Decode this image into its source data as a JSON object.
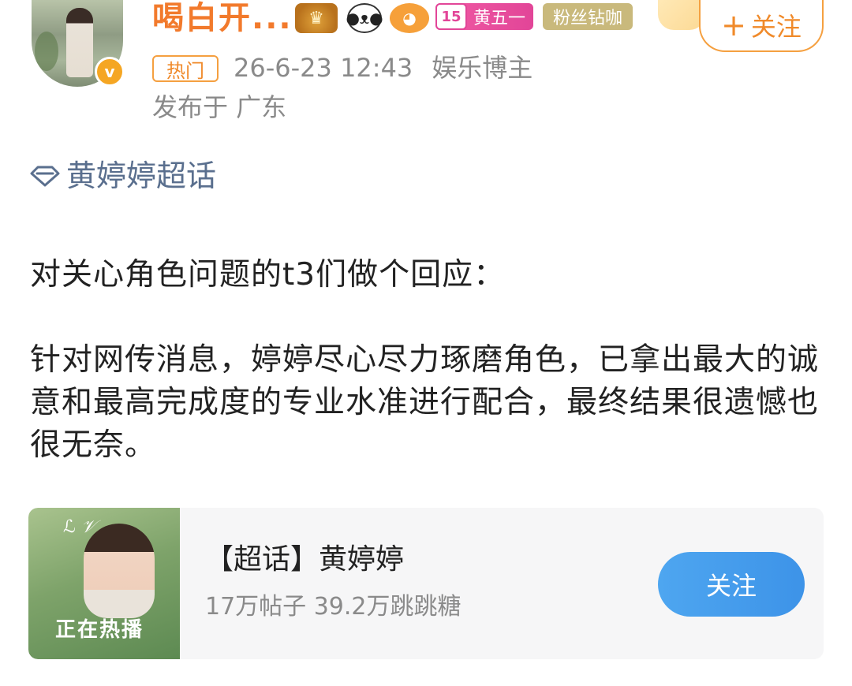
{
  "user": {
    "name": "喝白开...",
    "verified_mark": "v",
    "medals": [
      "crown-medal-icon",
      "panda-medal-icon",
      "fish-medal-icon"
    ],
    "level_badge": {
      "level": "15",
      "label": "黄五一"
    },
    "fan_badge": "粉丝钻咖",
    "follow_button": "关注",
    "follow_plus": "+"
  },
  "post_meta": {
    "hot_tag": "热门",
    "timestamp": "26-6-23 12:43",
    "category": "娱乐博主",
    "location": "发布于 广东"
  },
  "topic": {
    "label": "黄婷婷超话",
    "icon": "supertopic-diamond-icon"
  },
  "post": {
    "paragraphs": [
      "对关心角色问题的t3们做个回应：",
      "针对网传消息，婷婷尽心尽力琢磨角色，已拿出最大的诚意和最高完成度的专业水准进行配合，最终结果很遗憾也很无奈。"
    ]
  },
  "card": {
    "title": "【超话】黄婷婷",
    "stats": "17万帖子 39.2万跳跳糖",
    "follow_button": "关注",
    "thumb_caption": "正在热播"
  },
  "colors": {
    "accent_orange": "#f27a2c",
    "link_blue": "#5a6f8e",
    "follow_blue": "#3d93e8",
    "meta_gray": "#8a8a8a"
  }
}
